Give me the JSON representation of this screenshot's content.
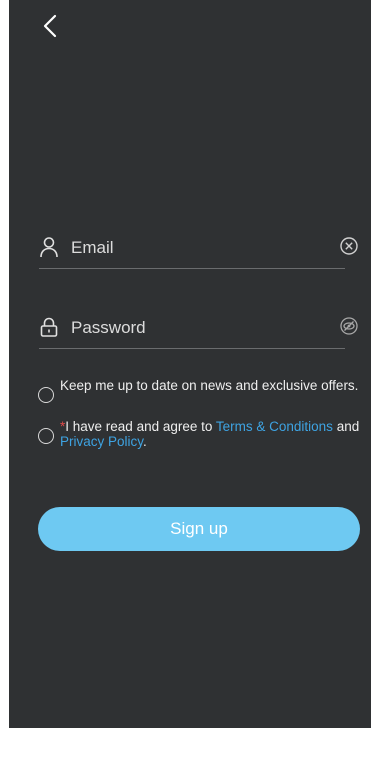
{
  "nav": {
    "back_icon": "chevron-left-icon"
  },
  "email": {
    "placeholder": "Email",
    "value": "",
    "lead_icon": "person-icon",
    "trail_icon": "clear-circle-x-icon"
  },
  "password": {
    "placeholder": "Password",
    "value": "",
    "lead_icon": "lock-icon",
    "trail_icon": "eye-hidden-icon"
  },
  "newsletter": {
    "label": "Keep me up to date on news and exclusive offers.",
    "checked": false
  },
  "terms": {
    "required_mark": "*",
    "text_before": "I have read and agree to ",
    "terms_link": "Terms & Conditions",
    "text_middle": " and ",
    "privacy_link": "Privacy Policy",
    "text_after": ".",
    "checked": false
  },
  "signup": {
    "label": "Sign up"
  },
  "colors": {
    "background": "#2f3133",
    "accent_button": "#6ec9f2",
    "link": "#3ea3e2",
    "required": "#e04a4a"
  }
}
